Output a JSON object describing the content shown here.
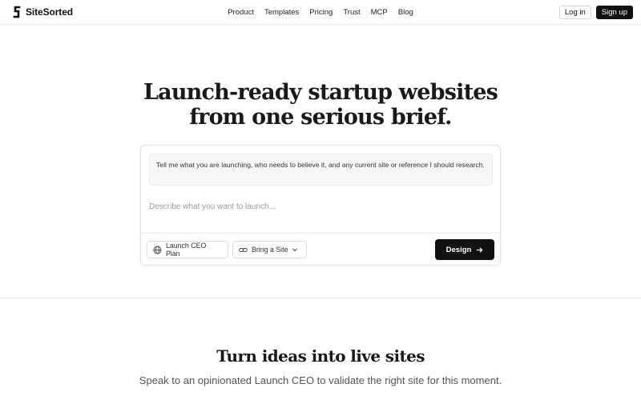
{
  "brand": {
    "name": "SiteSorted"
  },
  "nav": [
    {
      "label": "Product"
    },
    {
      "label": "Templates"
    },
    {
      "label": "Pricing"
    },
    {
      "label": "Trust"
    },
    {
      "label": "MCP"
    },
    {
      "label": "Blog"
    }
  ],
  "auth": {
    "login_label": "Log in",
    "signup_label": "Sign up"
  },
  "hero": {
    "title_line1": "Launch-ready startup websites",
    "title_line2": "from one serious brief."
  },
  "composer": {
    "hint": "Tell me what you are launching, who needs to believe it, and any current site or reference I should research.",
    "input_placeholder": "Describe what you want to launch...",
    "input_value": "",
    "plan_label": "Launch CEO Plan",
    "site_label": "Bring a Site",
    "design_label": "Design"
  },
  "section": {
    "title": "Turn ideas into live sites",
    "subtitle": "Speak to an opinionated Launch CEO to validate the right site for this moment."
  },
  "icons": {
    "brand": "logo-s-icon",
    "plan": "globe-icon",
    "site": "link-icon",
    "site_menu": "chevron-down-icon",
    "design": "arrow-right-icon"
  },
  "colors": {
    "primary": "#111111",
    "text_muted": "#555555",
    "placeholder": "#9a9a9a",
    "border": "#e3e3e3",
    "hint_bg": "#f7f7f7"
  }
}
